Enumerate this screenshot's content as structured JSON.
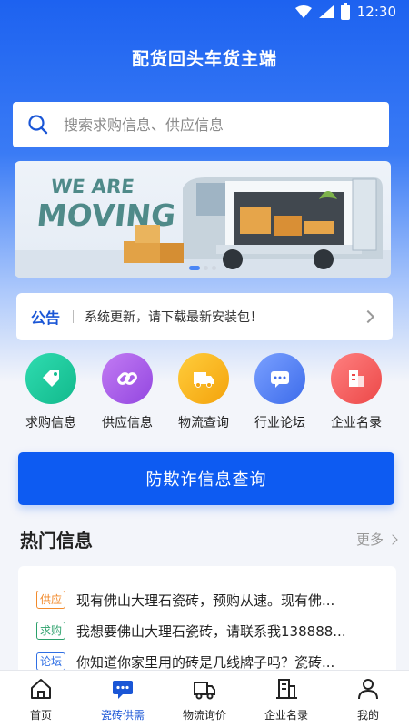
{
  "status_bar": {
    "time": "12:30",
    "icons": [
      "wifi-icon",
      "signal-icon",
      "battery-icon"
    ]
  },
  "app_title": "配货回头车货主端",
  "search": {
    "placeholder": "搜索求购信息、供应信息",
    "icon": "search-icon"
  },
  "banner": {
    "line1": "WE ARE",
    "line2": "MOVING",
    "page_count": 3,
    "active_page": 1
  },
  "notice": {
    "label": "公告",
    "text": "系统更新，请下载最新安装包！",
    "icon": "chevron-right-icon"
  },
  "quick_menu": [
    {
      "label": "求购信息",
      "icon": "tag-icon",
      "color": "#19c69a"
    },
    {
      "label": "供应信息",
      "icon": "link-icon",
      "color": "#a45ce8"
    },
    {
      "label": "物流查询",
      "icon": "truck-icon",
      "color": "#f7b219"
    },
    {
      "label": "行业论坛",
      "icon": "chat-icon",
      "color": "#4f7ef3"
    },
    {
      "label": "企业名录",
      "icon": "building-icon",
      "color": "#f05a5a"
    }
  ],
  "fraud_button": "防欺诈信息查询",
  "hot_section": {
    "title": "热门信息",
    "more": "更多",
    "items": [
      {
        "tag": "供应",
        "text": "现有佛山大理石瓷砖，预购从速。现有佛..."
      },
      {
        "tag": "求购",
        "text": "我想要佛山大理石瓷砖，请联系我138888..."
      },
      {
        "tag": "论坛",
        "text": "你知道你家里用的砖是几线牌子吗？瓷砖..."
      }
    ]
  },
  "tabbar": {
    "active_index": 1,
    "items": [
      {
        "label": "首页",
        "icon": "home-icon"
      },
      {
        "label": "瓷砖供需",
        "icon": "message-icon"
      },
      {
        "label": "物流询价",
        "icon": "truck-icon"
      },
      {
        "label": "企业名录",
        "icon": "building-icon"
      },
      {
        "label": "我的",
        "icon": "user-icon"
      }
    ]
  },
  "colors": {
    "primary": "#0d5bf2",
    "accent_blue": "#1a56d6"
  }
}
